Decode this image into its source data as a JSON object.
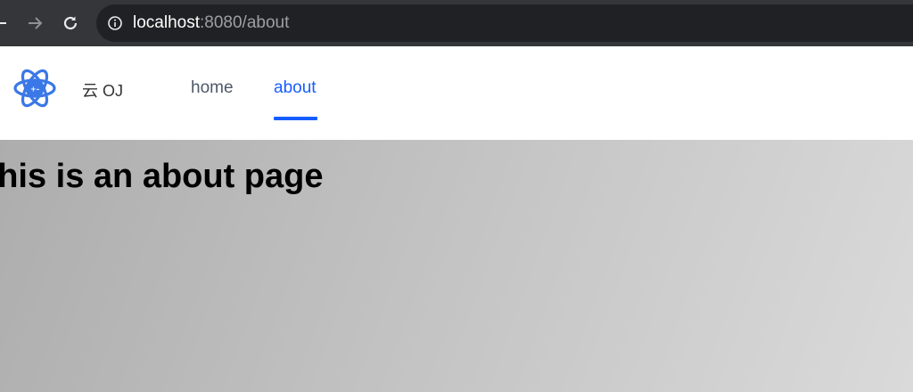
{
  "browser": {
    "url_host": "localhost",
    "url_rest": ":8080/about"
  },
  "header": {
    "brand": "云 OJ",
    "menu": [
      {
        "label": "home",
        "active": false
      },
      {
        "label": "about",
        "active": true
      }
    ],
    "accent_color": "#165dff"
  },
  "main": {
    "heading": "This is an about page"
  }
}
